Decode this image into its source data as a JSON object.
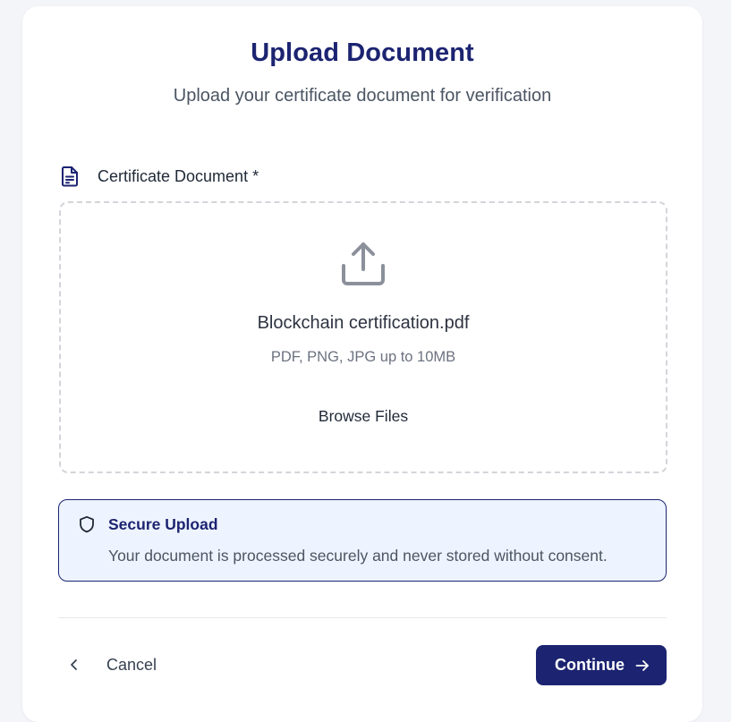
{
  "header": {
    "title": "Upload Document",
    "subtitle": "Upload your certificate document for verification"
  },
  "field": {
    "label": "Certificate Document *",
    "icon": "document-icon"
  },
  "dropzone": {
    "icon": "upload-icon",
    "file_name": "Blockchain certification.pdf",
    "hint": "PDF, PNG, JPG up to 10MB",
    "browse_label": "Browse Files"
  },
  "notice": {
    "icon": "shield-icon",
    "title": "Secure Upload",
    "body": "Your document is processed securely and never stored without consent."
  },
  "footer": {
    "cancel_label": "Cancel",
    "continue_label": "Continue"
  },
  "colors": {
    "accent": "#1c2471",
    "notice_bg": "#eef4ff",
    "page_bg": "#f4f5f9"
  }
}
